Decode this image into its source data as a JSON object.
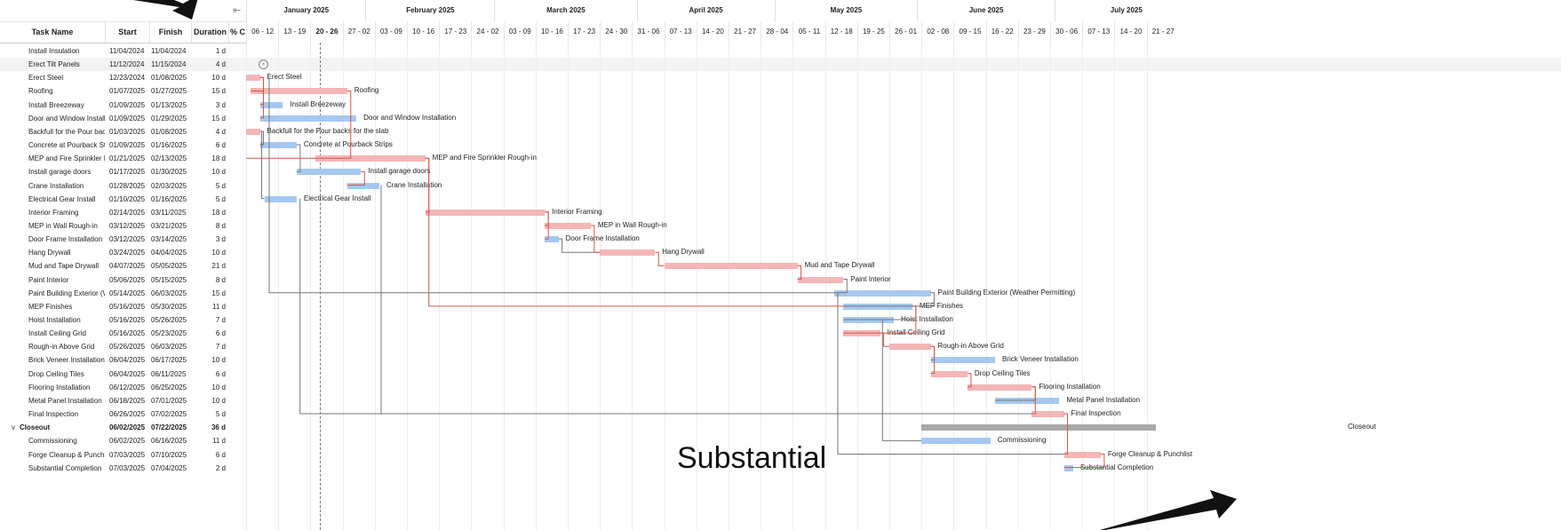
{
  "columns": {
    "task": "Task Name",
    "start": "Start",
    "finish": "Finish",
    "duration": "Duration",
    "pct": "% C"
  },
  "months": [
    "January 2025",
    "February 2025",
    "March 2025",
    "April 2025",
    "May 2025",
    "June 2025",
    "July 2025"
  ],
  "weeks": [
    "06 - 12",
    "13 - 19",
    "20 - 26",
    "27 - 02",
    "03 - 09",
    "10 - 16",
    "17 - 23",
    "24 - 02",
    "03 - 09",
    "10 - 16",
    "17 - 23",
    "24 - 30",
    "31 - 06",
    "07 - 13",
    "14 - 20",
    "21 - 27",
    "28 - 04",
    "05 - 11",
    "12 - 18",
    "19 - 25",
    "26 - 01",
    "02 - 08",
    "09 - 15",
    "16 - 22",
    "23 - 29",
    "30 - 06",
    "07 - 13",
    "14 - 20",
    "21 - 27"
  ],
  "tasks": [
    {
      "name": "Install Insulation",
      "start": "11/04/2024",
      "finish": "11/04/2024",
      "duration": "1 d"
    },
    {
      "name": "Erect Tilt Panels",
      "start": "11/12/2024",
      "finish": "11/15/2024",
      "duration": "4 d"
    },
    {
      "name": "Erect Steel",
      "start": "12/23/2024",
      "finish": "01/08/2025",
      "duration": "10 d",
      "bar_label": "Erect Steel"
    },
    {
      "name": "Roofing",
      "start": "01/07/2025",
      "finish": "01/27/2025",
      "duration": "15 d",
      "bar_label": "Roofing"
    },
    {
      "name": "Install Breezeway",
      "start": "01/09/2025",
      "finish": "01/13/2025",
      "duration": "3 d",
      "bar_label": "Install Breezeway"
    },
    {
      "name": "Door and Window Installa",
      "start": "01/09/2025",
      "finish": "01/29/2025",
      "duration": "15 d",
      "bar_label": "Door and Window Installation"
    },
    {
      "name": "Backfull for the Pour back",
      "start": "01/03/2025",
      "finish": "01/08/2025",
      "duration": "4 d",
      "bar_label": "Backfull for the Pour backs for the slab"
    },
    {
      "name": "Concrete at Pourback Str",
      "start": "01/09/2025",
      "finish": "01/16/2025",
      "duration": "6 d",
      "bar_label": "Concrete at Pourback Strips"
    },
    {
      "name": "MEP and Fire Sprinkler Ro",
      "start": "01/21/2025",
      "finish": "02/13/2025",
      "duration": "18 d",
      "bar_label": "MEP and Fire Sprinkler Rough-in"
    },
    {
      "name": "Install garage doors",
      "start": "01/17/2025",
      "finish": "01/30/2025",
      "duration": "10 d",
      "bar_label": "Install garage doors"
    },
    {
      "name": "Crane Installation",
      "start": "01/28/2025",
      "finish": "02/03/2025",
      "duration": "5 d",
      "bar_label": "Crane Installation"
    },
    {
      "name": "Electrical Gear Install",
      "start": "01/10/2025",
      "finish": "01/16/2025",
      "duration": "5 d",
      "bar_label": "Electrical Gear Install"
    },
    {
      "name": "Interior Framing",
      "start": "02/14/2025",
      "finish": "03/11/2025",
      "duration": "18 d",
      "bar_label": "Interior Framing"
    },
    {
      "name": "MEP in Wall Rough-in",
      "start": "03/12/2025",
      "finish": "03/21/2025",
      "duration": "8 d",
      "bar_label": "MEP in Wall Rough-in"
    },
    {
      "name": "Door Frame Installation",
      "start": "03/12/2025",
      "finish": "03/14/2025",
      "duration": "3 d",
      "bar_label": "Door Frame Installation"
    },
    {
      "name": "Hang Drywall",
      "start": "03/24/2025",
      "finish": "04/04/2025",
      "duration": "10 d",
      "bar_label": "Hang Drywall"
    },
    {
      "name": "Mud and Tape Drywall",
      "start": "04/07/2025",
      "finish": "05/05/2025",
      "duration": "21 d",
      "bar_label": "Mud and Tape Drywall"
    },
    {
      "name": "Paint Interior",
      "start": "05/06/2025",
      "finish": "05/15/2025",
      "duration": "8 d",
      "bar_label": "Paint Interior"
    },
    {
      "name": "Paint Building Exterior (W",
      "start": "05/14/2025",
      "finish": "06/03/2025",
      "duration": "15 d",
      "bar_label": "Paint Building Exterior (Weather Permitting)"
    },
    {
      "name": "MEP Finishes",
      "start": "05/16/2025",
      "finish": "05/30/2025",
      "duration": "11 d",
      "bar_label": "MEP Finishes"
    },
    {
      "name": "Hoist Installation",
      "start": "05/16/2025",
      "finish": "05/26/2025",
      "duration": "7 d",
      "bar_label": "Hoist Installation"
    },
    {
      "name": "Install Ceiling Grid",
      "start": "05/16/2025",
      "finish": "05/23/2025",
      "duration": "6 d",
      "bar_label": "Install Ceiling Grid"
    },
    {
      "name": "Rough-in Above Grid",
      "start": "05/26/2025",
      "finish": "06/03/2025",
      "duration": "7 d",
      "bar_label": "Rough-in Above Grid"
    },
    {
      "name": "Brick Veneer Installation",
      "start": "06/04/2025",
      "finish": "06/17/2025",
      "duration": "10 d",
      "bar_label": "Brick Veneer Installation"
    },
    {
      "name": "Drop Ceiling Tiles",
      "start": "06/04/2025",
      "finish": "06/11/2025",
      "duration": "6 d",
      "bar_label": "Drop Ceiling Tiles"
    },
    {
      "name": "Flooring Installation",
      "start": "06/12/2025",
      "finish": "06/25/2025",
      "duration": "10 d",
      "bar_label": "Flooring Installation"
    },
    {
      "name": "Metal Panel Installation",
      "start": "06/18/2025",
      "finish": "07/01/2025",
      "duration": "10 d",
      "bar_label": "Metal Panel Installation"
    },
    {
      "name": "Final Inspection",
      "start": "06/26/2025",
      "finish": "07/02/2025",
      "duration": "5 d",
      "bar_label": "Final Inspection"
    },
    {
      "name": "Closeout",
      "start": "06/02/2025",
      "finish": "07/22/2025",
      "duration": "36 d",
      "bar_label": "Closeout",
      "group": true
    },
    {
      "name": "Commissioning",
      "start": "06/02/2025",
      "finish": "06/16/2025",
      "duration": "11 d",
      "bar_label": "Commissioning"
    },
    {
      "name": "Forge Cleanup & Punchlis",
      "start": "07/03/2025",
      "finish": "07/10/2025",
      "duration": "6 d",
      "bar_label": "Forge Cleanup & Punchlist"
    },
    {
      "name": "Substantial Completion",
      "start": "07/03/2025",
      "finish": "07/04/2025",
      "duration": "2 d",
      "bar_label": "Substantial Completion"
    }
  ],
  "overlay_caption": "Substantial",
  "colors": {
    "critical": "#f4b6b6",
    "normal": "#a6c8f0",
    "summary": "#a9a9a9",
    "link_red": "#d9534f",
    "link_gray": "#777777"
  }
}
